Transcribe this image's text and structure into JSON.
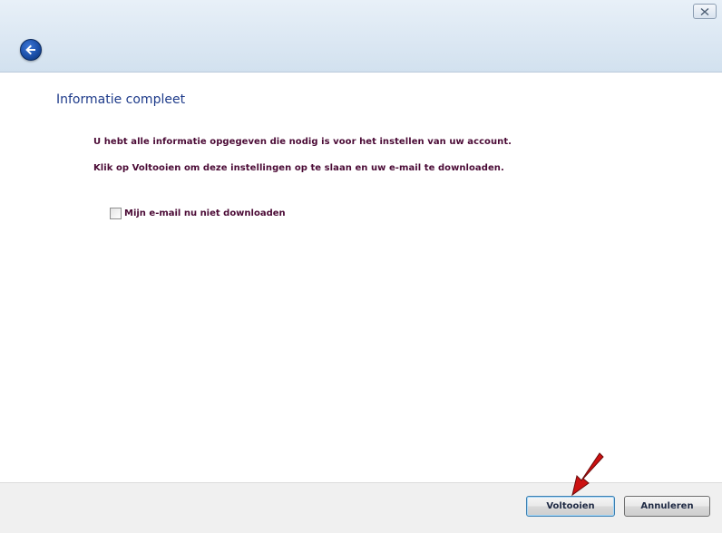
{
  "window": {
    "close_icon": "close-icon",
    "back_icon": "back-arrow-icon"
  },
  "main": {
    "title": "Informatie compleet",
    "line1": "U hebt alle informatie opgegeven die nodig is voor het instellen van uw account.",
    "line2": "Klik op Voltooien om deze instellingen op te slaan en uw e-mail te downloaden.",
    "checkbox": {
      "label": "Mijn e-mail nu niet downloaden",
      "checked": false
    }
  },
  "footer": {
    "finish_label": "Voltooien",
    "cancel_label": "Annuleren"
  },
  "annotation": {
    "arrow_color": "#cc1111",
    "arrow_icon": "red-pointer-arrow-icon"
  }
}
